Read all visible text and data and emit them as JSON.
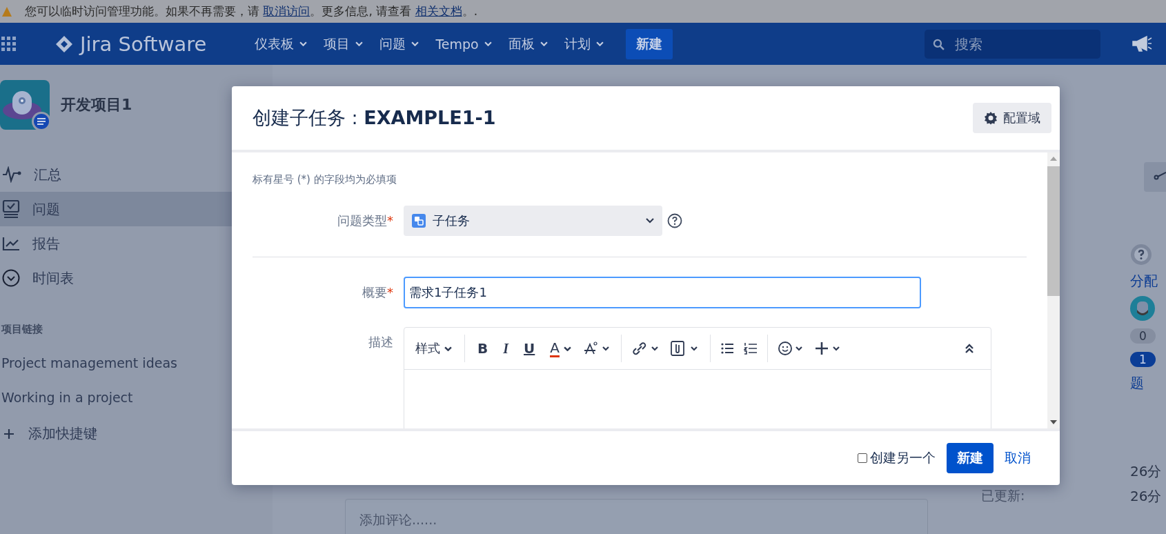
{
  "banner": {
    "before": "您可以临时访问管理功能。如果不再需要，请 ",
    "link1": "取消访问",
    "middle": "。更多信息, 请查看 ",
    "link2": "相关文档",
    "after": "。."
  },
  "nav": {
    "product": "Jira Software",
    "menus": [
      {
        "label": "仪表板"
      },
      {
        "label": "项目"
      },
      {
        "label": "问题"
      },
      {
        "label": "Tempo"
      },
      {
        "label": "面板"
      },
      {
        "label": "计划"
      }
    ],
    "create": "新建",
    "search": {
      "placeholder": "搜索"
    }
  },
  "sidebar": {
    "project": "开发项目1",
    "items": [
      {
        "label": "汇总",
        "selected": false
      },
      {
        "label": "问题",
        "selected": true
      },
      {
        "label": "报告",
        "selected": false
      },
      {
        "label": "时间表",
        "selected": false
      }
    ],
    "links_heading": "项目链接",
    "links": [
      "Project management ideas",
      "Working in a project"
    ],
    "add_shortcut": "添加快捷键"
  },
  "dialog": {
    "title": "创建子任务 : **EXAMPLE1-1**",
    "configure": "配置域",
    "required_note": "标有星号 (*) 的字段均为必填项",
    "issue_type": {
      "label": "问题类型",
      "required_mark": "*",
      "value": "子任务"
    },
    "summary": {
      "label": "概要",
      "required_mark": "*",
      "value": "需求1子任务1"
    },
    "description": {
      "label": "描述",
      "toolbar": [
        "样式",
        "B",
        "I",
        "U",
        "A"
      ]
    },
    "create_another": {
      "label": "创建另一个",
      "checked": false
    },
    "submit": "新建",
    "cancel": "取消"
  },
  "details": {
    "assignee_link": "分配",
    "votes": "0",
    "watchers_count": "1",
    "watchers_tail": "题",
    "created": "26分",
    "updated_label": "已更新:",
    "updated": "26分"
  },
  "comment": {
    "placeholder": "添加评论......"
  }
}
